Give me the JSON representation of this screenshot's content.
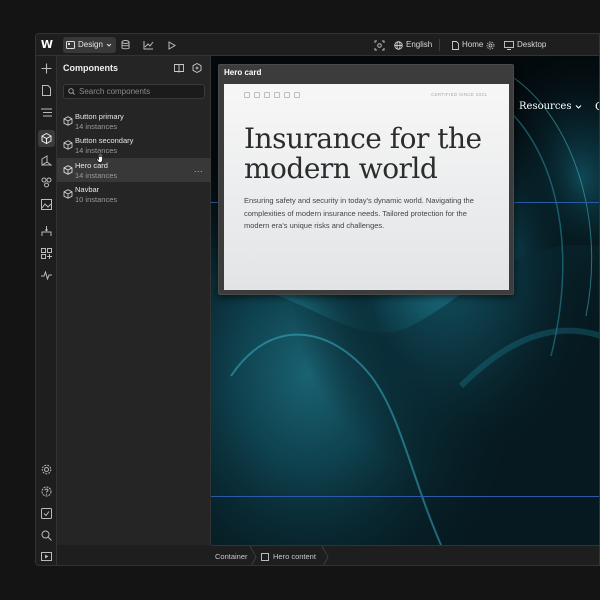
{
  "topbar": {
    "logo": "W",
    "mode_label": "Design",
    "language": "English",
    "page_label": "Home",
    "viewport_label": "Desktop"
  },
  "panel": {
    "title": "Components",
    "search_placeholder": "Search components",
    "items": [
      {
        "name": "Button primary",
        "count": "14 instances"
      },
      {
        "name": "Button secondary",
        "count": "14 instances"
      },
      {
        "name": "Hero card",
        "count": "14 instances"
      },
      {
        "name": "Navbar",
        "count": "10 instances"
      }
    ],
    "more_label": "..."
  },
  "hero_frame": {
    "label": "Hero card",
    "badge": "CERTIFIED SINCE 2021",
    "title": "Insurance for the modern world",
    "description": "Ensuring safety and security in today's dynamic world. Navigating the complexities of modern insurance needs. Tailored protection for the modern era's unique risks and challenges."
  },
  "canvas_nav": {
    "resources": "Resources",
    "partial": "C"
  },
  "breadcrumb": {
    "items": [
      "Container",
      "Hero content"
    ]
  },
  "colors": {
    "app_bg": "#1e1e1e",
    "panel_bg": "#252525",
    "accent_teal": "#1d7f93",
    "guide_blue": "#2d5aa8"
  }
}
